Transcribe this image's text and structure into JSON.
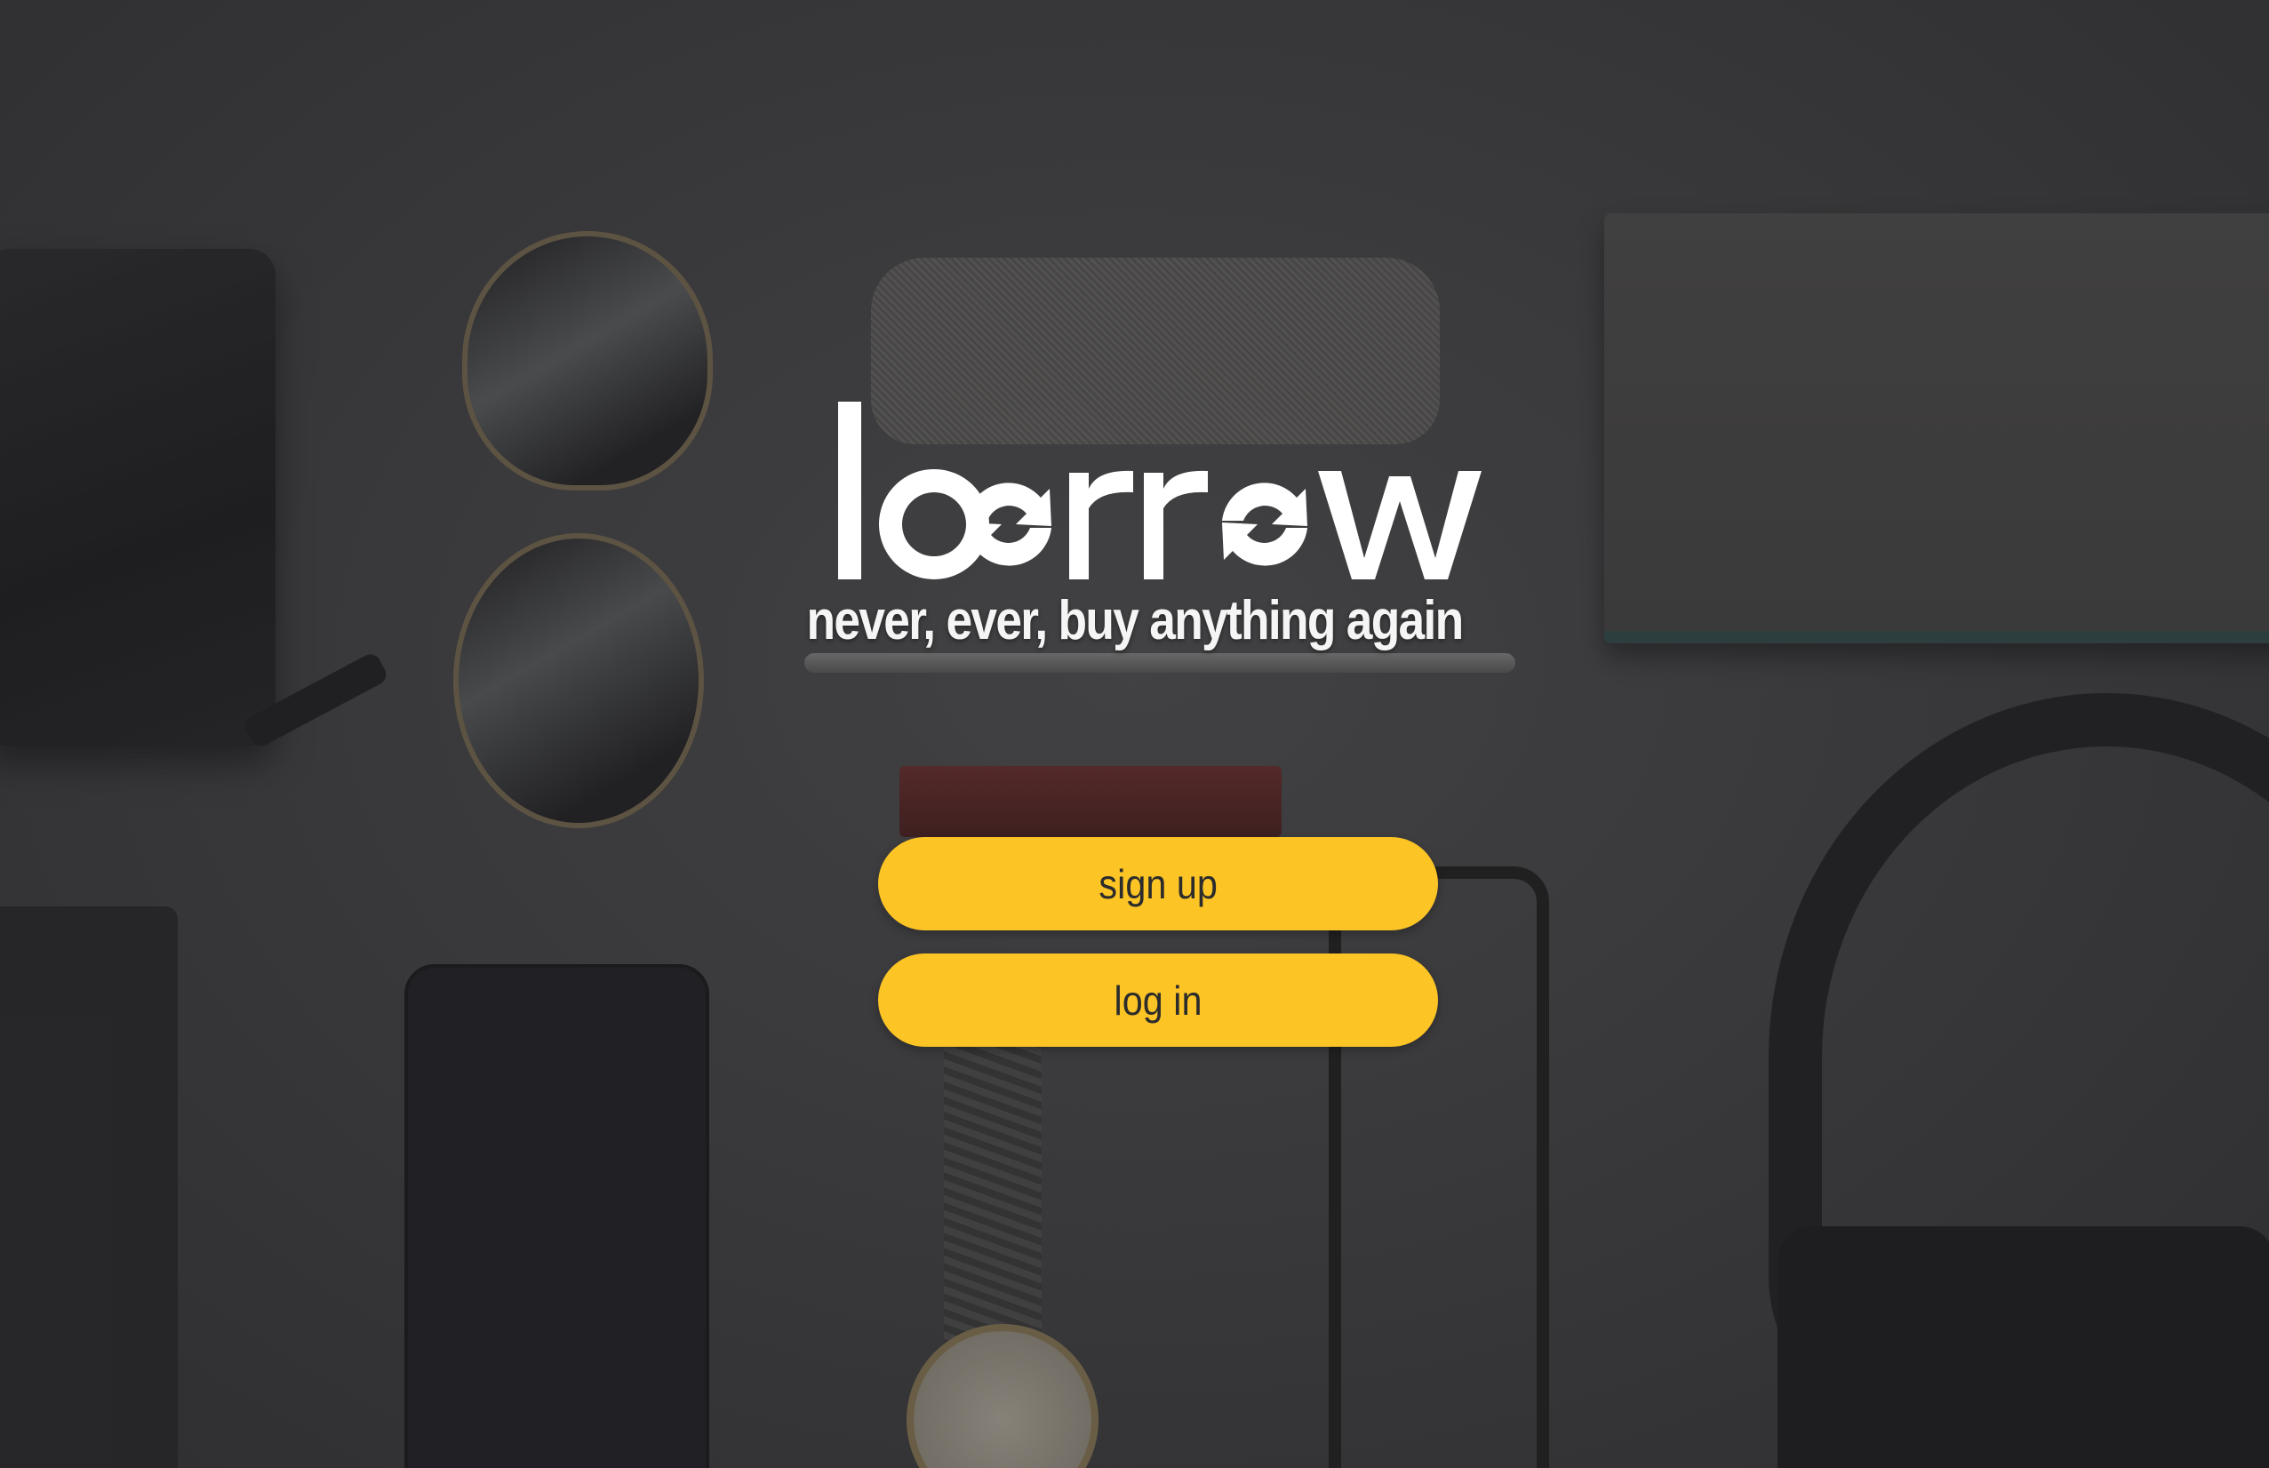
{
  "brand": {
    "logo_text": "borrow",
    "tagline": "never, ever, buy anything again"
  },
  "actions": {
    "signup_label": "sign up",
    "login_label": "log in"
  },
  "colors": {
    "button_bg": "#fcc424",
    "button_text": "#2c2c2c",
    "logo_text": "#ffffff"
  },
  "icons": {
    "logo_o_glyphs": "refresh-arrows-icon"
  }
}
